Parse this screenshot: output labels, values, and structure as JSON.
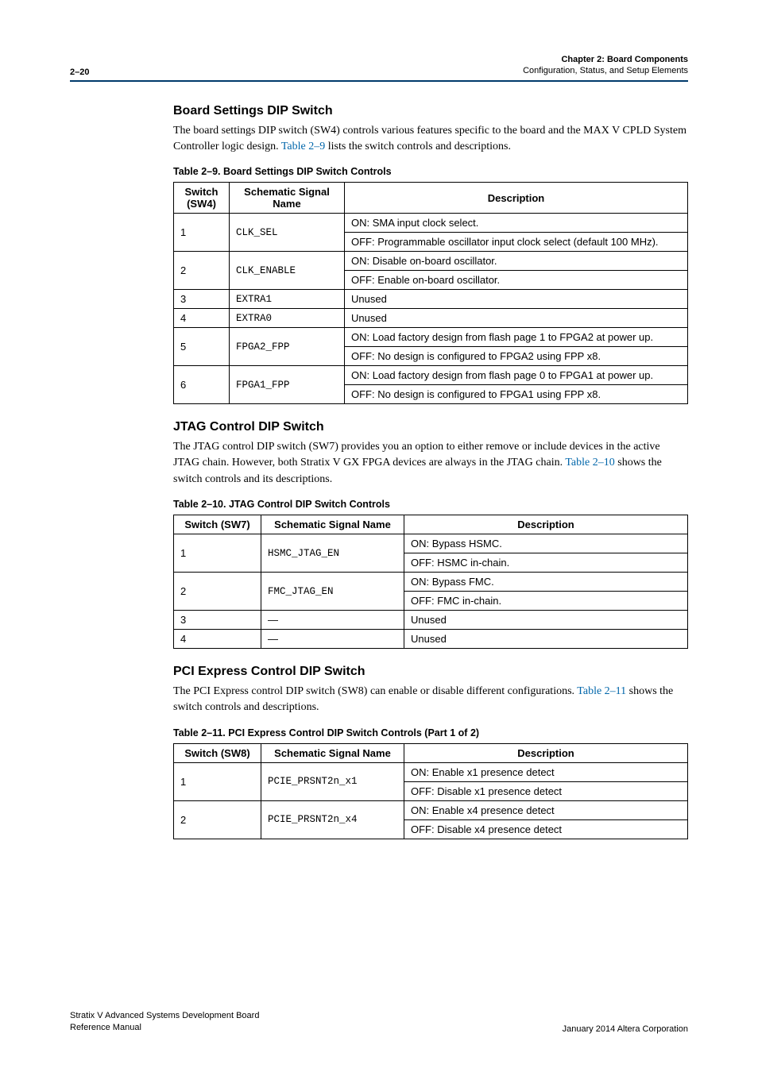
{
  "header": {
    "page_num": "2–20",
    "chapter": "Chapter 2:  Board Components",
    "sub": "Configuration, Status, and Setup Elements"
  },
  "sec1": {
    "title": "Board Settings DIP Switch",
    "para_a": "The board settings DIP switch (SW4) controls various features specific to the board and the MAX V CPLD System Controller logic design. ",
    "link": "Table 2–9",
    "para_b": " lists the switch controls and descriptions.",
    "caption": "Table 2–9.  Board Settings DIP Switch Controls",
    "th1": "Switch (SW4)",
    "th2": "Schematic Signal Name",
    "th3": "Description",
    "rows": [
      {
        "sw": "1",
        "sig": "CLK_SEL",
        "d1": "ON: SMA input clock select.",
        "d2": "OFF: Programmable oscillator input clock select (default 100 MHz)."
      },
      {
        "sw": "2",
        "sig": "CLK_ENABLE",
        "d1": "ON: Disable on-board oscillator.",
        "d2": "OFF: Enable on-board oscillator."
      },
      {
        "sw": "3",
        "sig": "EXTRA1",
        "d1": "Unused"
      },
      {
        "sw": "4",
        "sig": "EXTRA0",
        "d1": "Unused"
      },
      {
        "sw": "5",
        "sig": "FPGA2_FPP",
        "d1": "ON: Load factory design from flash page 1 to FPGA2 at power up.",
        "d2": "OFF: No design is configured to FPGA2 using FPP x8."
      },
      {
        "sw": "6",
        "sig": "FPGA1_FPP",
        "d1": "ON: Load factory design from flash page 0 to FPGA1 at power up.",
        "d2": "OFF: No design is configured to FPGA1 using FPP x8."
      }
    ]
  },
  "sec2": {
    "title": "JTAG Control DIP Switch",
    "para_a": "The JTAG control DIP switch (SW7) provides you an option to either remove or include devices in the active JTAG chain. However, both Stratix V GX FPGA devices are always in the JTAG chain. ",
    "link": "Table 2–10",
    "para_b": " shows the switch controls and its descriptions.",
    "caption": "Table 2–10.  JTAG Control DIP Switch Controls",
    "th1": "Switch (SW7)",
    "th2": "Schematic Signal Name",
    "th3": "Description",
    "rows": [
      {
        "sw": "1",
        "sig": "HSMC_JTAG_EN",
        "d1": "ON: Bypass HSMC.",
        "d2": "OFF: HSMC in-chain."
      },
      {
        "sw": "2",
        "sig": "FMC_JTAG_EN",
        "d1": "ON: Bypass FMC.",
        "d2": "OFF: FMC in-chain."
      },
      {
        "sw": "3",
        "sig": "—",
        "d1": "Unused"
      },
      {
        "sw": "4",
        "sig": "—",
        "d1": "Unused"
      }
    ]
  },
  "sec3": {
    "title": "PCI Express Control DIP Switch",
    "para_a": "The PCI Express control DIP switch (SW8) can enable or disable different configurations. ",
    "link": "Table 2–11",
    "para_b": " shows the switch controls and descriptions.",
    "caption": "Table 2–11.  PCI Express Control DIP Switch Controls  (Part 1 of 2)",
    "th1": "Switch (SW8)",
    "th2": "Schematic Signal Name",
    "th3": "Description",
    "rows": [
      {
        "sw": "1",
        "sig": "PCIE_PRSNT2n_x1",
        "d1": "ON: Enable x1 presence detect",
        "d2": "OFF: Disable x1 presence detect"
      },
      {
        "sw": "2",
        "sig": "PCIE_PRSNT2n_x4",
        "d1": "ON: Enable x4 presence detect",
        "d2": "OFF: Disable x4 presence detect"
      }
    ]
  },
  "footer": {
    "left1": "Stratix V Advanced Systems Development Board",
    "left2": "Reference Manual",
    "right": "January 2014   Altera Corporation"
  }
}
